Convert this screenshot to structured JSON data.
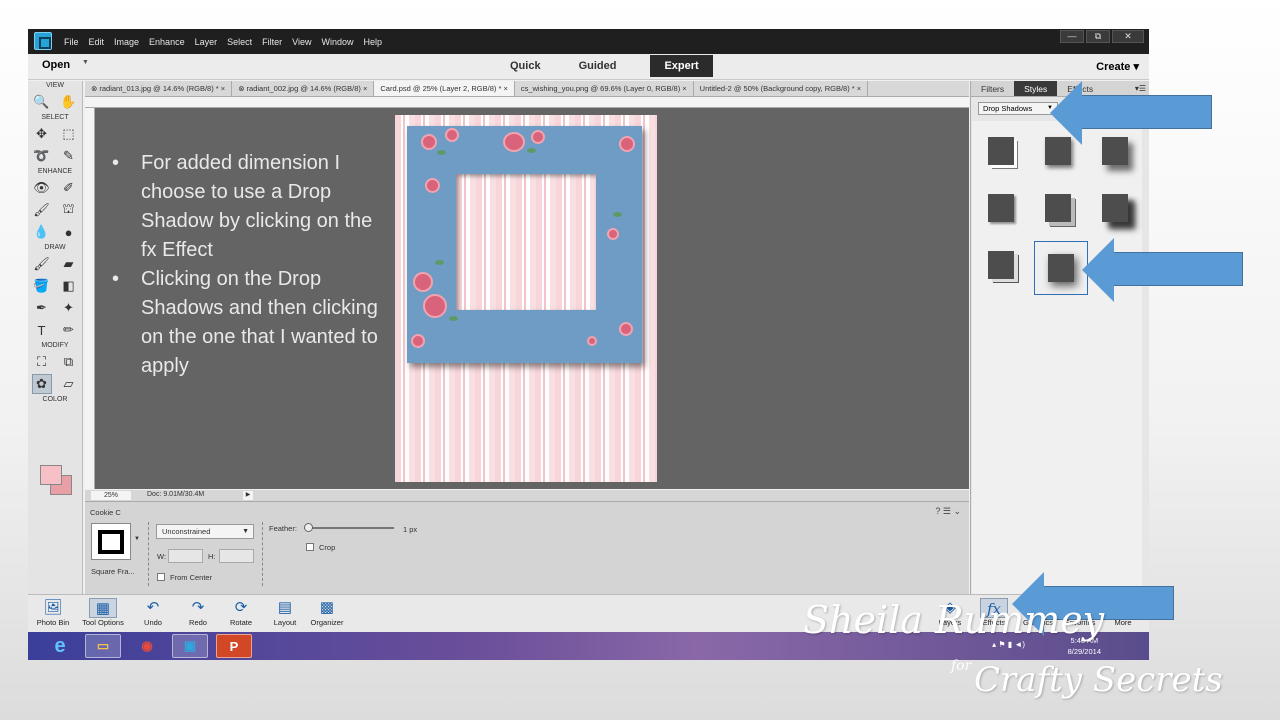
{
  "menu": [
    "File",
    "Edit",
    "Image",
    "Enhance",
    "Layer",
    "Select",
    "Filter",
    "View",
    "Window",
    "Help"
  ],
  "window_controls": {
    "minimize": "—",
    "restore": "⧉",
    "close": "✕"
  },
  "modebar": {
    "open": "Open",
    "modes": [
      "Quick",
      "Guided",
      "Expert"
    ],
    "active_mode": "Expert",
    "create": "Create"
  },
  "tabs": [
    "⊗ radiant_013.jpg @ 14.6% (RGB/8) * ×",
    "⊗ radiant_002.jpg @ 14.6% (RGB/8) ×",
    "Card.psd @ 25% (Layer 2, RGB/8) * ×",
    "cs_wishing_you.png @ 69.6% (Layer 0, RGB/8) ×",
    "Untitled-2 @ 50% (Background copy, RGB/8) * ×"
  ],
  "toolbox": {
    "sections": [
      "VIEW",
      "SELECT",
      "ENHANCE",
      "DRAW",
      "MODIFY",
      "COLOR"
    ]
  },
  "status": {
    "zoom": "25%",
    "doc": "Doc: 9.01M/30.4M"
  },
  "options": {
    "title": "Cookie C",
    "shape_label": "Square Fra...",
    "constraint": "Unconstrained",
    "w_label": "W:",
    "h_label": "H:",
    "from_center": "From Center",
    "feather": "Feather:",
    "feather_value": "1 px",
    "crop": "Crop"
  },
  "panel": {
    "tabs": [
      "Filters",
      "Styles",
      "Effects"
    ],
    "active_tab": "Styles",
    "dropdown": "Drop Shadows"
  },
  "bottombar": [
    "Photo Bin",
    "Tool Options",
    "Undo",
    "Redo",
    "Rotate",
    "Layout",
    "Organizer"
  ],
  "bottombar_right": [
    "Layers",
    "Effects",
    "Graphics",
    "Favorites",
    "More"
  ],
  "taskbar": {
    "time": "5:48 AM",
    "date": "8/29/2014"
  },
  "slide": {
    "bullets": [
      "For added dimension I choose to use a Drop Shadow by clicking on the fx Effect",
      "Clicking on the Drop Shadows and then clicking on the one that I wanted to apply"
    ]
  },
  "watermark": {
    "name": "Sheila Rummey",
    "for": "for",
    "brand": "Crafty Secrets"
  },
  "colors": {
    "accent_arrow": "#5b9bd5",
    "foreground": "#f6c0c6",
    "background": "#e8a0a6"
  }
}
